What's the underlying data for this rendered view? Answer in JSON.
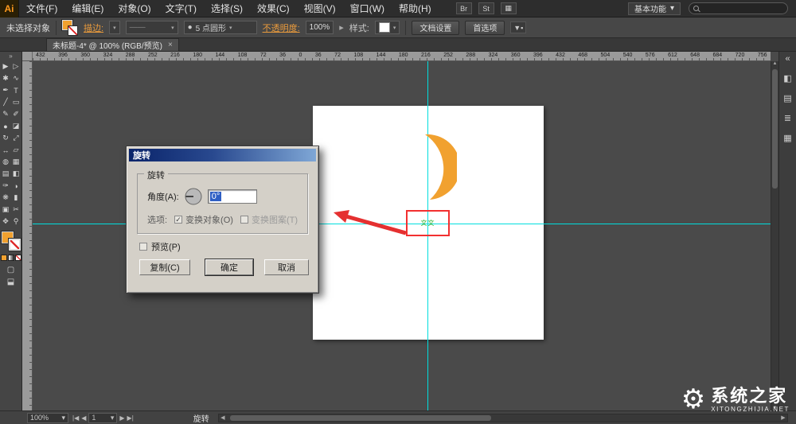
{
  "menu_bar": {
    "logo": "Ai",
    "items": [
      "文件(F)",
      "编辑(E)",
      "对象(O)",
      "文字(T)",
      "选择(S)",
      "效果(C)",
      "视图(V)",
      "窗口(W)",
      "帮助(H)"
    ],
    "bridge_label": "Br",
    "stock_label": "St",
    "workspace_label": "基本功能",
    "workspace_chevron": "▾",
    "search_placeholder": ""
  },
  "control_bar": {
    "selection_status": "未选择对象",
    "stroke_label": "描边:",
    "brush_dot": "●",
    "brush_name": "5 点圆形",
    "opacity_label": "不透明度:",
    "opacity_value": "100%",
    "opacity_arrow": "▸",
    "style_label": "样式:",
    "doc_setup_label": "文档设置",
    "preferences_label": "首选项",
    "chevron": "▾"
  },
  "document_tab": {
    "title": "未标题-4* @ 100% (RGB/预览)",
    "close": "×"
  },
  "ruler": {
    "numbers": [
      "432",
      "396",
      "360",
      "324",
      "288",
      "252",
      "216",
      "180",
      "144",
      "108",
      "72",
      "36",
      "0",
      "36",
      "72",
      "108",
      "144",
      "180",
      "216",
      "252",
      "288",
      "324",
      "360",
      "396",
      "432",
      "468",
      "504",
      "540",
      "576",
      "612",
      "648",
      "684",
      "720",
      "756"
    ]
  },
  "toolbar": {
    "collapse": "»",
    "tools": [
      {
        "name": "selection-tool-icon",
        "glyph": "▶"
      },
      {
        "name": "direct-selection-tool-icon",
        "glyph": "▷"
      },
      {
        "name": "magic-wand-tool-icon",
        "glyph": "✱"
      },
      {
        "name": "lasso-tool-icon",
        "glyph": "∿"
      },
      {
        "name": "pen-tool-icon",
        "glyph": "✒"
      },
      {
        "name": "type-tool-icon",
        "glyph": "T"
      },
      {
        "name": "line-segment-tool-icon",
        "glyph": "╱"
      },
      {
        "name": "rectangle-tool-icon",
        "glyph": "▭"
      },
      {
        "name": "paintbrush-tool-icon",
        "glyph": "✎"
      },
      {
        "name": "pencil-tool-icon",
        "glyph": "✐"
      },
      {
        "name": "blob-brush-tool-icon",
        "glyph": "●"
      },
      {
        "name": "eraser-tool-icon",
        "glyph": "◪"
      },
      {
        "name": "rotate-tool-icon",
        "glyph": "↻"
      },
      {
        "name": "scale-tool-icon",
        "glyph": "⤢"
      },
      {
        "name": "width-tool-icon",
        "glyph": "↔"
      },
      {
        "name": "free-transform-tool-icon",
        "glyph": "▱"
      },
      {
        "name": "shape-builder-tool-icon",
        "glyph": "◍"
      },
      {
        "name": "perspective-grid-tool-icon",
        "glyph": "▦"
      },
      {
        "name": "mesh-tool-icon",
        "glyph": "▤"
      },
      {
        "name": "gradient-tool-icon",
        "glyph": "◧"
      },
      {
        "name": "eyedropper-tool-icon",
        "glyph": "✑"
      },
      {
        "name": "blend-tool-icon",
        "glyph": "◑"
      },
      {
        "name": "symbol-sprayer-tool-icon",
        "glyph": "❋"
      },
      {
        "name": "column-graph-tool-icon",
        "glyph": "▮"
      },
      {
        "name": "artboard-tool-icon",
        "glyph": "▣"
      },
      {
        "name": "slice-tool-icon",
        "glyph": "✂"
      },
      {
        "name": "hand-tool-icon",
        "glyph": "✥"
      },
      {
        "name": "zoom-tool-icon",
        "glyph": "⚲"
      }
    ],
    "draw_mode_glyph": "▢",
    "screen_mode_glyph": "⬓"
  },
  "canvas": {
    "object_label": "文文"
  },
  "dialog": {
    "title": "旋转",
    "group_title": "旋转",
    "angle_label": "角度(A):",
    "angle_value": "0°",
    "options_label": "选项:",
    "transform_object_check": "✓",
    "transform_object_label": "变换对象(O)",
    "transform_pattern_label": "变换图案(T)",
    "preview_label": "预览(P)",
    "copy_button": "复制(C)",
    "ok_button": "确定",
    "cancel_button": "取消"
  },
  "status_bar": {
    "zoom_value": "100%",
    "first": "|◀",
    "prev": "◀",
    "page_value": "1",
    "next": "▶",
    "last": "▶|",
    "tool_name": "旋转",
    "chevron": "▾"
  },
  "right_panels": [
    {
      "name": "collapse-panels-icon",
      "glyph": "«"
    },
    {
      "name": "color-panel-icon",
      "glyph": "◧"
    },
    {
      "name": "appearance-panel-icon",
      "glyph": "▤"
    },
    {
      "name": "layers-panel-icon",
      "glyph": "≣"
    },
    {
      "name": "swatches-panel-icon",
      "glyph": "▦"
    }
  ],
  "watermark": {
    "name": "系统之家",
    "domain": "XITONGZHIJIA.NET"
  },
  "colors": {
    "accent_orange": "#F1A12F",
    "guide_cyan": "#00DEDE",
    "selection_red": "#F23030",
    "object_green": "#2BB22B",
    "dialog_title_blue": "#0A246A",
    "ui_dark": "#2D2D2D"
  }
}
